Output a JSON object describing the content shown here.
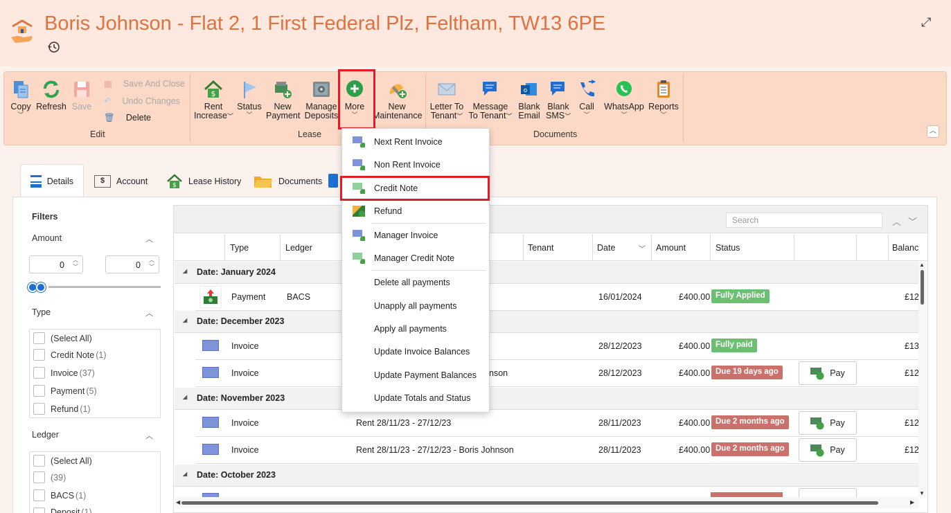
{
  "header": {
    "title": "Boris Johnson - Flat 2, 1 First Federal Plz, Feltham, TW13 6PE"
  },
  "ribbon": {
    "edit": {
      "copy": "Copy",
      "refresh": "Refresh",
      "save": "Save",
      "save_and_close": "Save And Close",
      "undo_changes": "Undo Changes",
      "delete": "Delete",
      "group_label": "Edit"
    },
    "lease": {
      "rent_increase_1": "Rent",
      "rent_increase_2": "Increase",
      "status": "Status",
      "new_payment_1": "New",
      "new_payment_2": "Payment",
      "manage_deposits_1": "Manage",
      "manage_deposits_2": "Deposits",
      "more": "More",
      "new_maintenance_1": "New",
      "new_maintenance_2": "Maintenance",
      "group_label": "Lease"
    },
    "documents": {
      "letter_1": "Letter To",
      "letter_2": "Tenant",
      "message_1": "Message",
      "message_2": "To Tenant",
      "blank_email_1": "Blank",
      "blank_email_2": "Email",
      "blank_sms_1": "Blank",
      "blank_sms_2": "SMS",
      "call": "Call",
      "whatsapp": "WhatsApp",
      "reports": "Reports",
      "group_label": "Documents"
    }
  },
  "tabs": {
    "details": "Details",
    "account": "Account",
    "lease_history": "Lease History",
    "documents": "Documents"
  },
  "filters": {
    "title": "Filters",
    "amount": {
      "label": "Amount",
      "min": "0",
      "max": "0"
    },
    "type": {
      "label": "Type",
      "items": [
        {
          "label": "(Select All)",
          "count": ""
        },
        {
          "label": "Credit Note",
          "count": "(1)"
        },
        {
          "label": "Invoice",
          "count": "(37)"
        },
        {
          "label": "Payment",
          "count": "(5)"
        },
        {
          "label": "Refund",
          "count": "(1)"
        }
      ]
    },
    "ledger": {
      "label": "Ledger",
      "items": [
        {
          "label": "(Select All)",
          "count": ""
        },
        {
          "label": "",
          "count": "(39)"
        },
        {
          "label": "BACS",
          "count": "(1)"
        },
        {
          "label": "Deposit",
          "count": "(1)"
        }
      ]
    }
  },
  "grid": {
    "search_placeholder": "Search",
    "columns": {
      "type": "Type",
      "ledger": "Ledger",
      "tenant": "Tenant",
      "date": "Date",
      "amount": "Amount",
      "status": "Status",
      "balance": "Balanc"
    },
    "groups": {
      "jan2024": "Date: January 2024",
      "dec2023": "Date: December 2023",
      "nov2023": "Date: November 2023",
      "oct2023": "Date: October 2023"
    },
    "rows": [
      {
        "type": "Payment",
        "ledger": "BACS",
        "desc": "",
        "date": "16/01/2024",
        "amount": "£400.00",
        "status": "Fully Applied",
        "pay": "",
        "balance": "£12"
      },
      {
        "type": "Invoice",
        "ledger": "",
        "desc": "",
        "date": "28/12/2023",
        "amount": "£400.00",
        "status": "Fully paid",
        "pay": "",
        "balance": "£13"
      },
      {
        "type": "Invoice",
        "ledger": "",
        "desc": "nson",
        "date": "28/12/2023",
        "amount": "£400.00",
        "status": "Due 19 days ago",
        "pay": "Pay",
        "balance": "£12"
      },
      {
        "type": "Invoice",
        "ledger": "",
        "desc": "Rent 28/11/23 - 27/12/23",
        "date": "28/11/2023",
        "amount": "£400.00",
        "status": "Due 2 months ago",
        "pay": "Pay",
        "balance": "£12"
      },
      {
        "type": "Invoice",
        "ledger": "",
        "desc": "Rent 28/11/23 - 27/12/23 - Boris Johnson",
        "date": "28/11/2023",
        "amount": "£400.00",
        "status": "Due 2 months ago",
        "pay": "Pay",
        "balance": "£12"
      }
    ]
  },
  "more_menu": {
    "items": [
      "Next Rent Invoice",
      "Non Rent Invoice",
      "Credit Note",
      "Refund",
      "Manager Invoice",
      "Manager Credit Note",
      "Delete all payments",
      "Unapply all payments",
      "Apply all payments",
      "Update Invoice Balances",
      "Update Payment Balances",
      "Update Totals and Status"
    ]
  },
  "colors": {
    "accent": "#e0723f",
    "ribbon": "#fcd9c6",
    "highlight": "#e21d2a",
    "badge_green": "#6cbf72",
    "badge_red": "#c9716a"
  }
}
